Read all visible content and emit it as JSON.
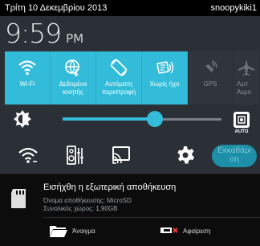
{
  "status_bar": {
    "date": "Τρίτη 10 Δεκεμβρίου 2013",
    "user": "snoopykiki1"
  },
  "clock": {
    "time": "9:59",
    "ampm": "PM"
  },
  "tiles": [
    {
      "label": "Wi-Fi",
      "state": "on",
      "icon": "wifi-icon"
    },
    {
      "label": "Δεδομένα κινητής",
      "state": "on",
      "icon": "mobile-data-icon"
    },
    {
      "label": "Αυτόματη περιστροφή",
      "state": "on",
      "icon": "auto-rotate-icon"
    },
    {
      "label": "Χωρίς ήχο",
      "state": "on",
      "icon": "silent-icon"
    },
    {
      "label": "GPS",
      "state": "off",
      "icon": "gps-icon"
    },
    {
      "label": "Λειτ Αερο",
      "state": "off",
      "icon": "airplane-icon"
    }
  ],
  "brightness": {
    "level": 0.58,
    "auto_label": "AUTO"
  },
  "quick_actions": {
    "button_label": "Εκκαθάρι ση"
  },
  "notification": {
    "title": "Εισήχθη η εξωτερική αποθήκευση",
    "storage_name": "Όνομα αποθήκευσης: MicroSD",
    "total_space": "Συνολικός χώρος: 1,90GB",
    "open_label": "Άνοιγμα",
    "remove_label": "Αφαίρεση"
  },
  "colors": {
    "accent": "#33bcd9",
    "panel": "#2a3036",
    "notification_bg": "#0c0c0c"
  }
}
